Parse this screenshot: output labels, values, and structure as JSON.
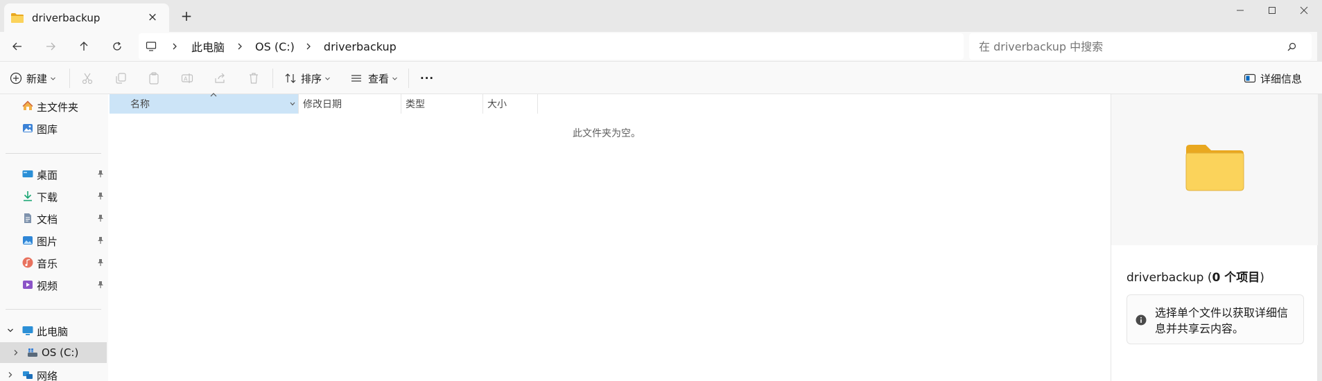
{
  "window": {
    "tab_title": "driverbackup",
    "tab_close": "×",
    "new_tab": "+"
  },
  "address": {
    "breadcrumbs": [
      "此电脑",
      "OS (C:)",
      "driverbackup"
    ]
  },
  "search": {
    "placeholder": "在 driverbackup 中搜索"
  },
  "toolbar": {
    "new_label": "新建",
    "sort_label": "排序",
    "view_label": "查看",
    "more_label": "···",
    "details_label": "详细信息"
  },
  "sidebar": {
    "quick": [
      {
        "label": "主文件夹",
        "icon": "home-icon"
      },
      {
        "label": "图库",
        "icon": "gallery-icon"
      }
    ],
    "pinned": [
      {
        "label": "桌面",
        "icon": "desktop-icon"
      },
      {
        "label": "下载",
        "icon": "download-icon"
      },
      {
        "label": "文档",
        "icon": "document-icon"
      },
      {
        "label": "图片",
        "icon": "pictures-icon"
      },
      {
        "label": "音乐",
        "icon": "music-icon"
      },
      {
        "label": "视频",
        "icon": "video-icon"
      }
    ],
    "this_pc": "此电脑",
    "drive": "OS (C:)",
    "network": "网络"
  },
  "columns": {
    "name": "名称",
    "date": "修改日期",
    "type": "类型",
    "size": "大小"
  },
  "content": {
    "empty_message": "此文件夹为空。"
  },
  "details": {
    "folder_name": "driverbackup",
    "count_open": "(",
    "count_bold": "0 个项目",
    "count_close": ")",
    "info_text": "选择单个文件以获取详细信息并共享云内容。"
  },
  "colors": {
    "accent": "#0067c0",
    "selected_column": "#cce4f7",
    "folder_yellow": "#f8c938"
  }
}
